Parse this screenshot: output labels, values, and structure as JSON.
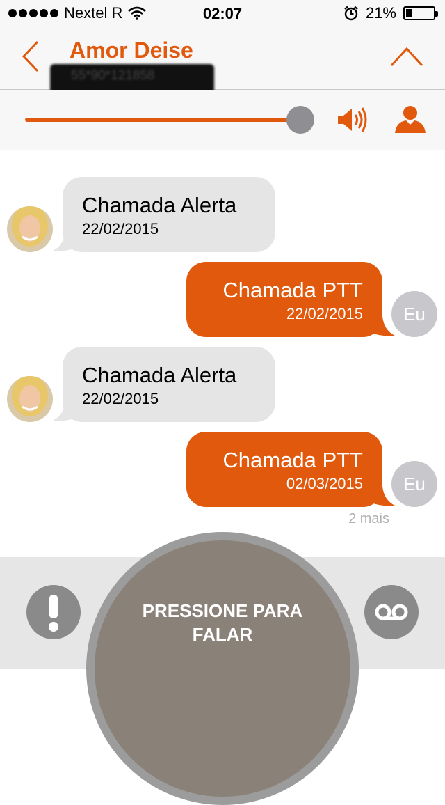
{
  "status_bar": {
    "carrier": "Nextel R",
    "time": "02:07",
    "battery": "21%",
    "battery_level": 0.21
  },
  "header": {
    "title": "Amor Deise",
    "phone_masked": "55*90*121858"
  },
  "volume": {
    "level": 1.0
  },
  "messages": [
    {
      "direction": "in",
      "title": "Chamada Alerta",
      "date": "22/02/2015"
    },
    {
      "direction": "out",
      "title": "Chamada PTT",
      "date": "22/02/2015",
      "avatar_label": "Eu"
    },
    {
      "direction": "in",
      "title": "Chamada Alerta",
      "date": "22/02/2015"
    },
    {
      "direction": "out",
      "title": "Chamada PTT",
      "date": "02/03/2015",
      "avatar_label": "Eu"
    }
  ],
  "more_label": "2 mais",
  "bottom": {
    "ptt_line1": "PRESSIONE PARA",
    "ptt_line2": "FALAR"
  },
  "colors": {
    "accent": "#e0590d",
    "incoming_bubble": "#e5e5e5",
    "ptt_button": "#8a8178"
  },
  "icons": [
    "back-chevron-icon",
    "collapse-chevron-icon",
    "speaker-icon",
    "contact-icon",
    "alert-icon",
    "voicemail-icon",
    "wifi-icon",
    "alarm-icon"
  ]
}
